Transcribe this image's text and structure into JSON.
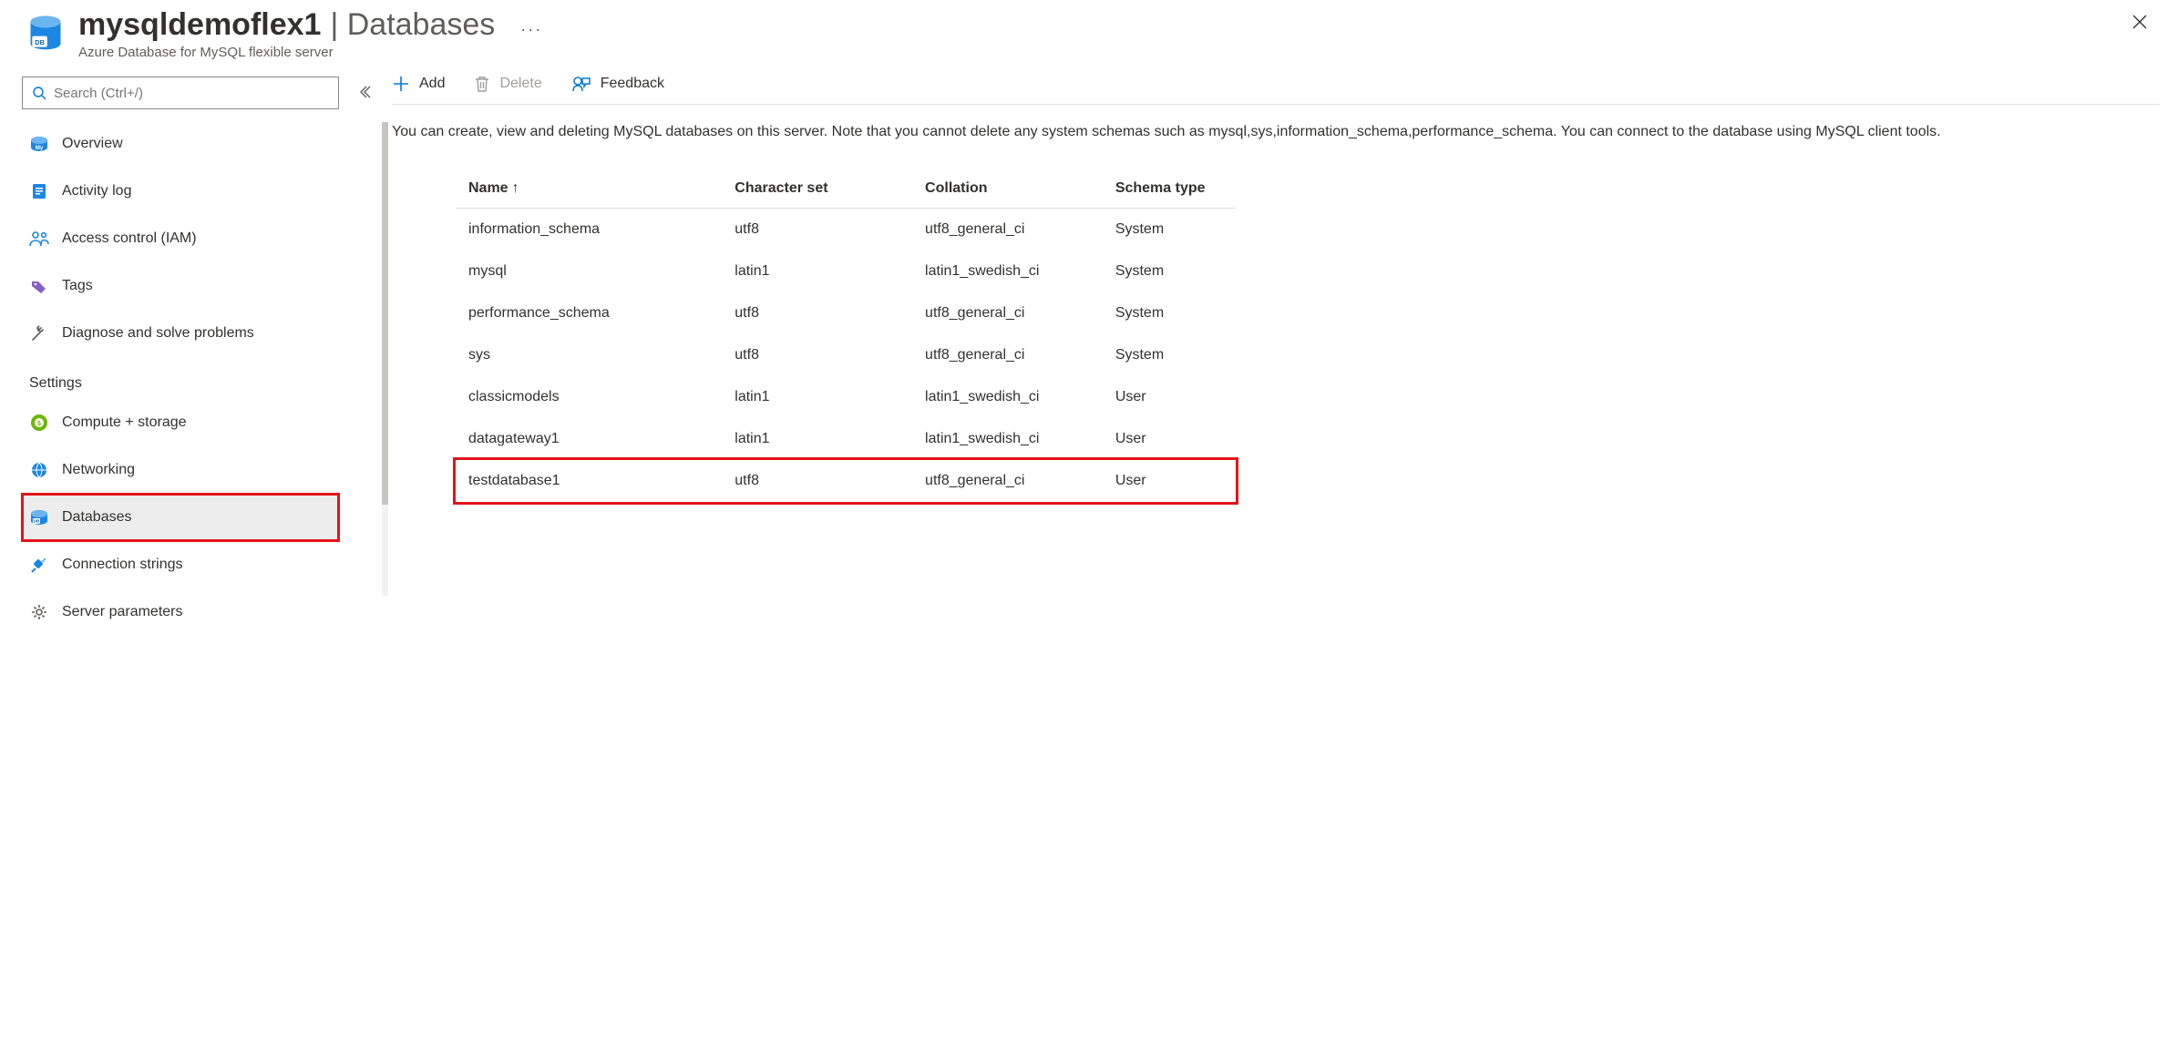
{
  "header": {
    "title": "mysqldemoflex1",
    "section": "| Databases",
    "subtitle": "Azure Database for MySQL flexible server"
  },
  "search": {
    "placeholder": "Search (Ctrl+/)"
  },
  "nav": {
    "overview": "Overview",
    "activity": "Activity log",
    "iam": "Access control (IAM)",
    "tags": "Tags",
    "diagnose": "Diagnose and solve problems",
    "settings_header": "Settings",
    "compute": "Compute + storage",
    "networking": "Networking",
    "databases": "Databases",
    "connection": "Connection strings",
    "params": "Server parameters"
  },
  "toolbar": {
    "add": "Add",
    "delete": "Delete",
    "feedback": "Feedback"
  },
  "description": "You can create, view and deleting MySQL databases on this server. Note that you cannot delete any system schemas such as mysql,sys,information_schema,performance_schema. You can connect to the database using MySQL client tools.",
  "table": {
    "headers": {
      "name": "Name",
      "charset": "Character set",
      "collation": "Collation",
      "schema": "Schema type"
    },
    "rows": [
      {
        "name": "information_schema",
        "charset": "utf8",
        "collation": "utf8_general_ci",
        "schema": "System"
      },
      {
        "name": "mysql",
        "charset": "latin1",
        "collation": "latin1_swedish_ci",
        "schema": "System"
      },
      {
        "name": "performance_schema",
        "charset": "utf8",
        "collation": "utf8_general_ci",
        "schema": "System"
      },
      {
        "name": "sys",
        "charset": "utf8",
        "collation": "utf8_general_ci",
        "schema": "System"
      },
      {
        "name": "classicmodels",
        "charset": "latin1",
        "collation": "latin1_swedish_ci",
        "schema": "User"
      },
      {
        "name": "datagateway1",
        "charset": "latin1",
        "collation": "latin1_swedish_ci",
        "schema": "User"
      },
      {
        "name": "testdatabase1",
        "charset": "utf8",
        "collation": "utf8_general_ci",
        "schema": "User"
      }
    ]
  }
}
